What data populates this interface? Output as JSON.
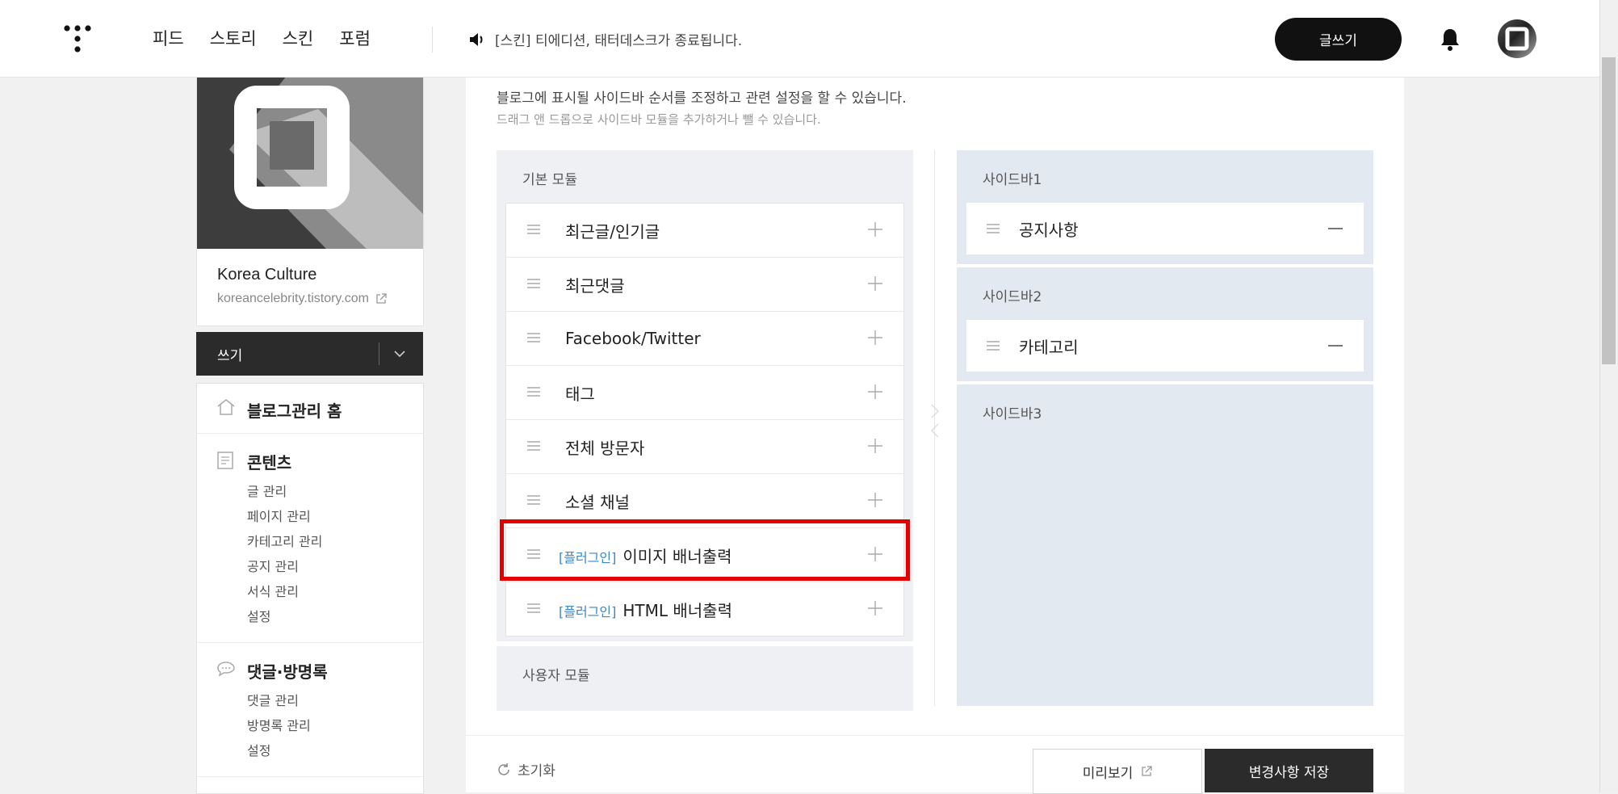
{
  "header": {
    "logo_icon": "tistory-logo-icon",
    "nav": [
      "피드",
      "스토리",
      "스킨",
      "포럼"
    ],
    "notice": "[스킨] 티에디션, 태터데스크가 종료됩니다.",
    "write_button": "글쓰기",
    "bell_icon": "bell-icon",
    "avatar_icon": "avatar"
  },
  "blog": {
    "name": "Korea Culture",
    "url": "koreancelebrity.tistory.com",
    "write_label": "쓰기"
  },
  "menu": {
    "home": "블로그관리 홈",
    "contents": {
      "title": "콘텐츠",
      "items": [
        "글 관리",
        "페이지 관리",
        "카테고리 관리",
        "공지 관리",
        "서식 관리",
        "설정"
      ]
    },
    "comments": {
      "title": "댓글·방명록",
      "items": [
        "댓글 관리",
        "방명록 관리",
        "설정"
      ]
    }
  },
  "main": {
    "desc1": "블로그에 표시될 사이드바 순서를 조정하고 관련 설정을 할 수 있습니다.",
    "desc2": "드래그 앤 드롭으로 사이드바 모듈을 추가하거나 뺄 수 있습니다.",
    "basic_title": "기본 모듈",
    "basic_modules": [
      {
        "tag": "",
        "name": "최근글/인기글"
      },
      {
        "tag": "",
        "name": "최근댓글"
      },
      {
        "tag": "",
        "name": "Facebook/Twitter"
      },
      {
        "tag": "",
        "name": "태그"
      },
      {
        "tag": "",
        "name": "전체 방문자"
      },
      {
        "tag": "",
        "name": "소셜 채널"
      },
      {
        "tag": "[플러그인]",
        "name": "이미지 배너출력"
      },
      {
        "tag": "[플러그인]",
        "name": "HTML 배너출력"
      }
    ],
    "user_title": "사용자 모듈",
    "sidebars": [
      {
        "title": "사이드바1",
        "modules": [
          "공지사항"
        ]
      },
      {
        "title": "사이드바2",
        "modules": [
          "카테고리"
        ]
      },
      {
        "title": "사이드바3",
        "modules": []
      }
    ],
    "reset": "초기화",
    "preview": "미리보기",
    "save": "변경사항 저장"
  },
  "colors": {
    "highlight": "#e30000",
    "plugin_tag": "#3a87c9",
    "dark_button": "#2b2b2b"
  }
}
